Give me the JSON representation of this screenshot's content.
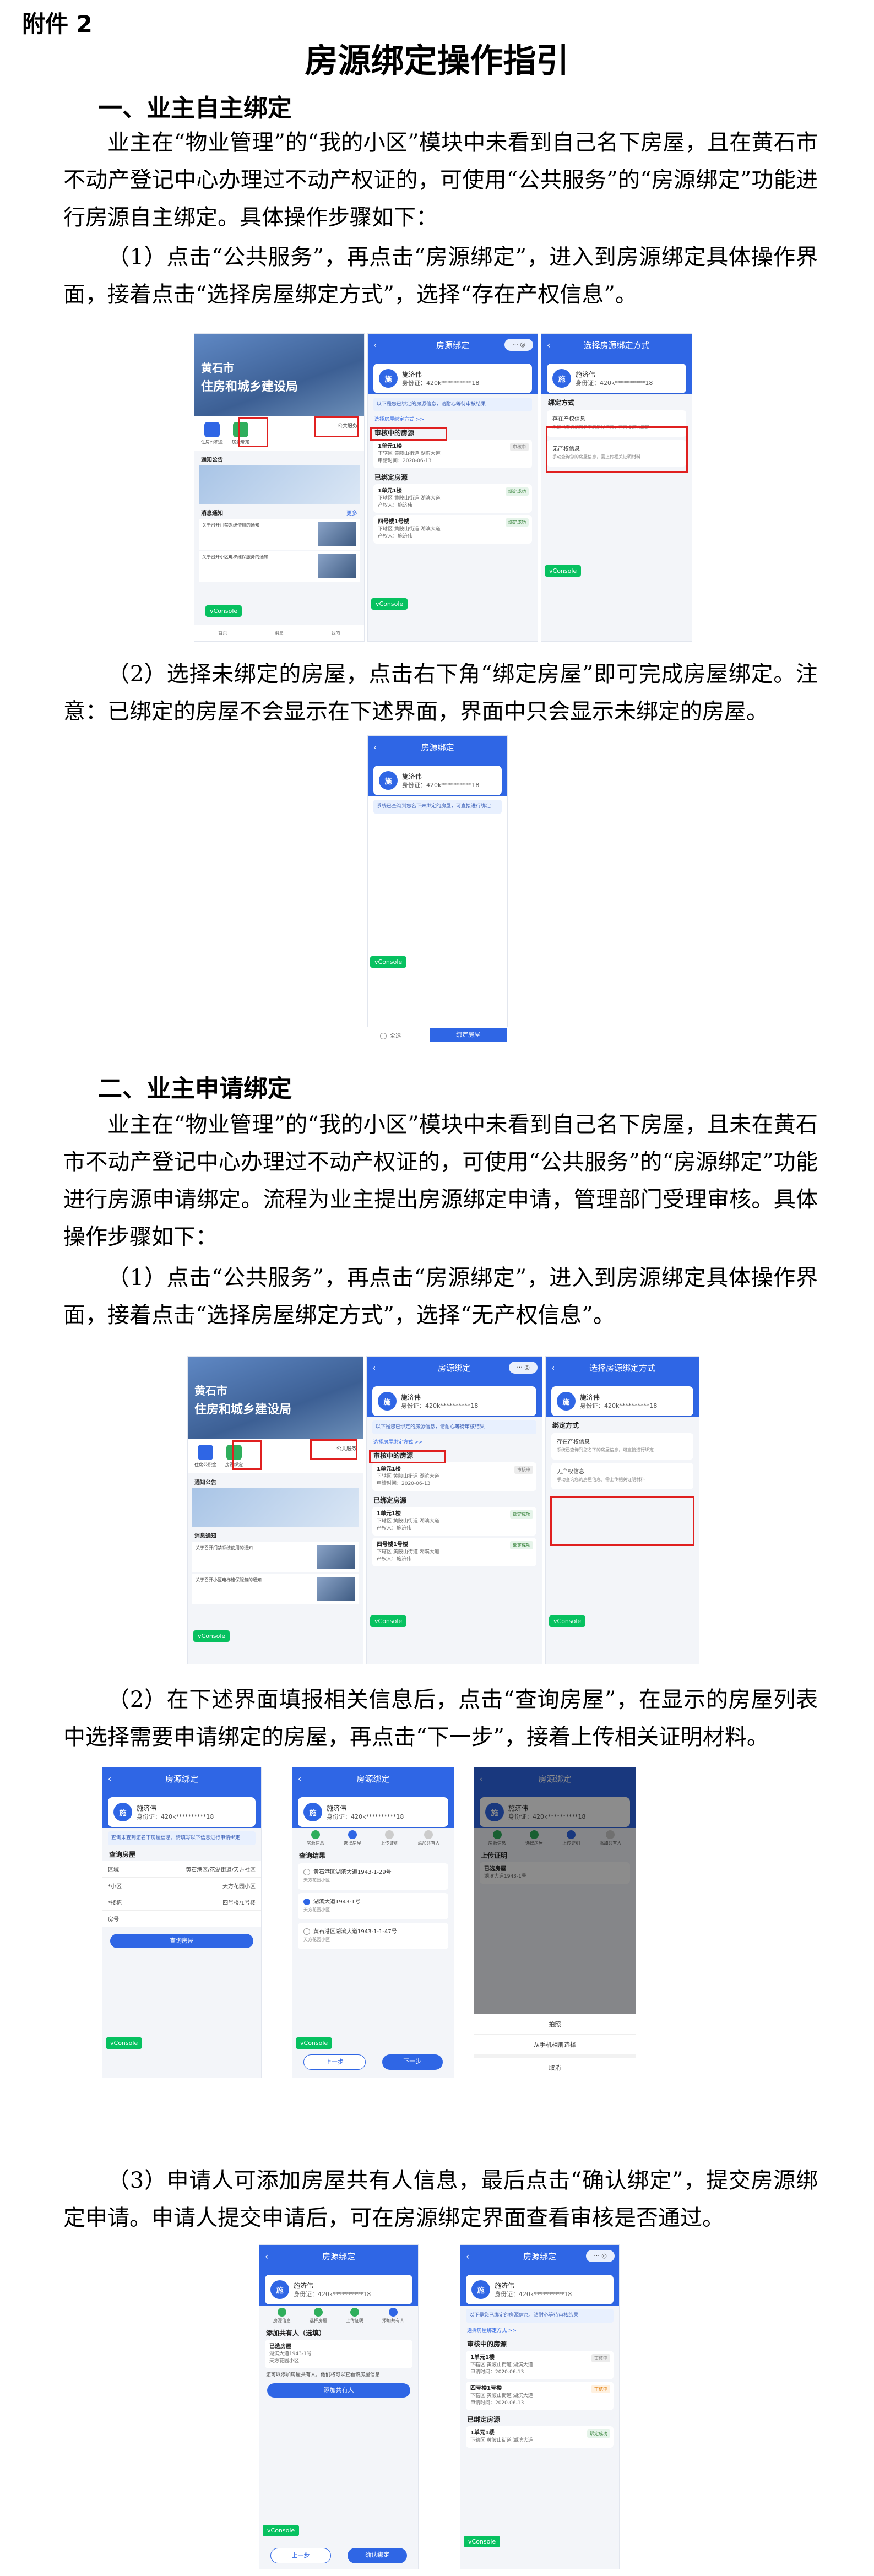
{
  "doc": {
    "attachment": "附件 2",
    "title": "房源绑定操作指引",
    "s1_heading": "一、业主自主绑定",
    "s1_p1": "业主在“物业管理”的“我的小区”模块中未看到自己名下房屋，且在黄石市不动产登记中心办理过不动产权证的，可使用“公共服务”的“房源绑定”功能进行房源自主绑定。具体操作步骤如下：",
    "s1_p2": "（1）点击“公共服务”，再点击“房源绑定”，进入到房源绑定具体操作界面，接着点击“选择房屋绑定方式”，选择“存在产权信息”。",
    "s1_p3": "（2）选择未绑定的房屋，点击右下角“绑定房屋”即可完成房屋绑定。注意：已绑定的房屋不会显示在下述界面，界面中只会显示未绑定的房屋。",
    "s2_heading": "二、业主申请绑定",
    "s2_p1": "业主在“物业管理”的“我的小区”模块中未看到自己名下房屋，且未在黄石市不动产登记中心办理过不动产权证的，可使用“公共服务”的“房源绑定”功能进行房源申请绑定。流程为业主提出房源绑定申请，管理部门受理审核。具体操作步骤如下：",
    "s2_p2": "（1）点击“公共服务”，再点击“房源绑定”，进入到房源绑定具体操作界面，接着点击“选择房屋绑定方式”，选择“无产权信息”。",
    "s2_p3": "（2）在下述界面填报相关信息后，点击“查询房屋”，在显示的房屋列表中选择需要申请绑定的房屋，再点击“下一步”，接着上传相关证明材料。",
    "s2_p4": "（3）申请人可添加房屋共有人信息，最后点击“确认绑定”，提交房源绑定申请。申请人提交申请后，可在房源绑定界面查看审核是否通过。"
  },
  "ui": {
    "hero_line1": "黄石市",
    "hero_line2": "住房和城乡建设局",
    "public_service": "公共服务",
    "icon_a": "住房公积金",
    "icon_b": "房源绑定",
    "notice_tab": "通知公告",
    "news_title": "消息通知",
    "news_more": "更多",
    "news1": "关于召开门禁系统使用的通知",
    "news2": "关于召开小区电梯维保服务的通知",
    "tab_home": "首页",
    "tab_msg": "消息",
    "tab_me": "我的",
    "bind_title": "房源绑定",
    "choose_title": "选择房源绑定方式",
    "user_name": "施济伟",
    "user_id": "身份证：420k**********18",
    "tip": "以下是您已绑定的房源信息，请耐心等待审核结果",
    "choose_link": "选择房屋绑定方式 >>",
    "reviewing": "审核中的房源",
    "bound": "已绑定房源",
    "house_row_sub": "下辖区 黄陂山街道 湖滨大道",
    "date_line": "申请时间：2020-06-13",
    "owner_line": "产权人：施济伟",
    "tag_review": "审核中",
    "tag_bound": "绑定成功",
    "method_label": "绑定方式",
    "opt_has": "存在产权信息",
    "opt_has_desc": "系统已查询到您名下的房屋信息，可直接进行绑定",
    "opt_no": "无产权信息",
    "opt_no_desc": "手动查询您的房屋信息，需上传相关证明材料",
    "vconsole": "vConsole",
    "unbound_tip": "系统已查询到您名下未绑定的房屋，可直接进行绑定",
    "select_all": "全选",
    "bind_house": "绑定房屋",
    "query_tip": "查询未查到您名下房屋信息，请填写以下信息进行申请绑定",
    "query_house": "查询房屋",
    "f_area_label": "区域",
    "f_area_val": "黄石港区/花湖街道/天方社区",
    "f_estate_label": "*小区",
    "f_estate_val": "天方花园小区",
    "f_bld_label": "*楼栋",
    "f_bld_val": "四号楼/1号楼",
    "f_room_label": "房号",
    "query_result": "查询结果",
    "res1": "黄石港区湖滨大道1943-1-29号",
    "res2": "湖滨大道1943-1号",
    "res3": "黄石港区湖滨大道1943-1-1-47号",
    "res_sub": "天方花园小区",
    "prev": "上一步",
    "next": "下一步",
    "step1": "房源信息",
    "step2": "选择房屋",
    "step3": "上传证明",
    "step4": "添加共有人",
    "upload_title": "上传证明",
    "upload_sub": "已选房屋",
    "sheet_photo": "拍照",
    "sheet_album": "从手机相册选择",
    "sheet_cancel": "取消",
    "add_coowner_title": "添加共有人（选填）",
    "selected_house": "已选房屋",
    "coowner_desc": "您可以添加房屋共有人，他们将可以查看该房屋信息",
    "add_coowner": "添加共有人",
    "confirm_bind": "确认绑定",
    "house_a": "1单元1楼",
    "house_b": "四号楼1号楼"
  }
}
